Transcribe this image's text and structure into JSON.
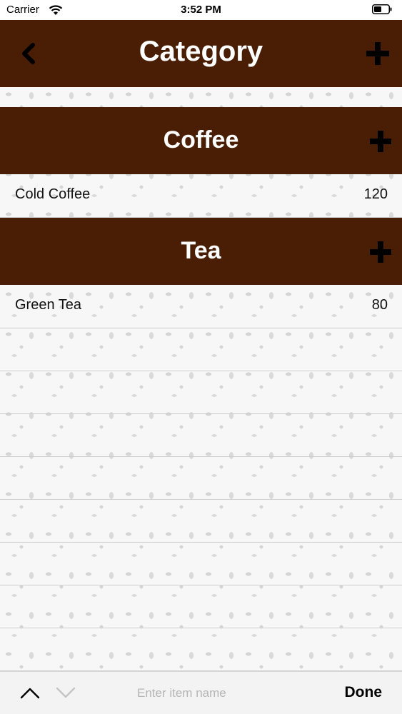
{
  "status_bar": {
    "carrier": "Carrier",
    "time": "3:52 PM"
  },
  "nav": {
    "title": "Category",
    "back_icon": "chevron-left-icon",
    "add_icon": "plus-icon"
  },
  "sections": [
    {
      "title": "Coffee",
      "items": [
        {
          "name": "Cold Coffee",
          "price": "120"
        }
      ]
    },
    {
      "title": "Tea",
      "items": [
        {
          "name": "Green Tea",
          "price": "80"
        }
      ]
    }
  ],
  "toolbar": {
    "input_placeholder": "Enter item name",
    "done_label": "Done"
  },
  "colors": {
    "header_brown": "#4a1d05",
    "background": "#f7f7f7",
    "toolbar": "#f3f3f3"
  }
}
